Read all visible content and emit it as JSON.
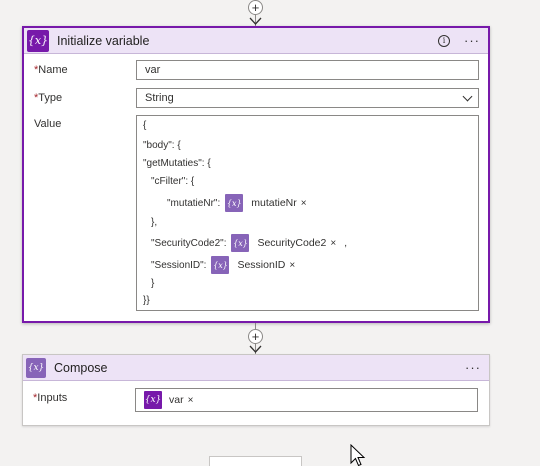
{
  "card_initialize": {
    "icon": "{x}",
    "title": "Initialize variable",
    "fields": {
      "name_label": "Name",
      "name_value": "var",
      "type_label": "Type",
      "type_value": "String",
      "value_label": "Value",
      "required_mark": "*"
    },
    "code": {
      "l1": "{",
      "l2": "\"body\": {",
      "l3": "\"getMutaties\": {",
      "l4": "\"cFilter\": {",
      "l5_key": "\"mutatieNr\":",
      "l5_token": "mutatieNr",
      "l6": "},",
      "l7_key": "\"SecurityCode2\":",
      "l7_token": "SecurityCode2",
      "l7_suffix": ",",
      "l8_key": "\"SessionID\":",
      "l8_token": "SessionID",
      "l9": "}",
      "l10": "}}",
      "token_icon": "{x}",
      "close": "×"
    }
  },
  "card_compose": {
    "icon": "{x}",
    "title": "Compose",
    "inputs_label": "Inputs",
    "required_mark": "*",
    "token_icon": "{x}",
    "token_label": "var",
    "close": "×"
  },
  "connectors": {
    "plus": "+"
  },
  "icons": [
    "variable-icon",
    "info-icon",
    "more-icon",
    "chevron-down-icon",
    "close-icon",
    "add-icon",
    "compose-icon",
    "mouse-cursor-icon"
  ],
  "colors": {
    "accent": "#7719aa",
    "header_bg": "#ede3f6",
    "token_icon": "#8764b8",
    "canvas": "#f3f2f1"
  }
}
